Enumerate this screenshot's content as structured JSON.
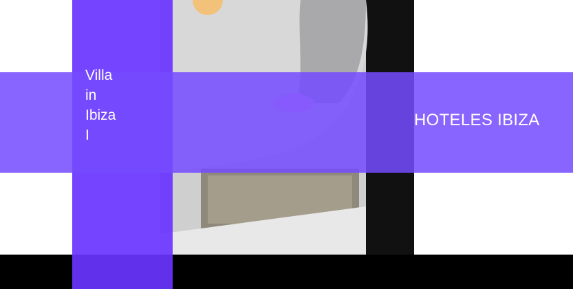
{
  "header": {
    "site_title": "Villa\nin\nIbiza\nI",
    "nav_link": "HOTELES IBIZA"
  },
  "colors": {
    "accent": "#6a35ff",
    "band": "#7a4cff",
    "bar": "#000000"
  },
  "hero": {
    "image": "interior-architecture-photo"
  }
}
